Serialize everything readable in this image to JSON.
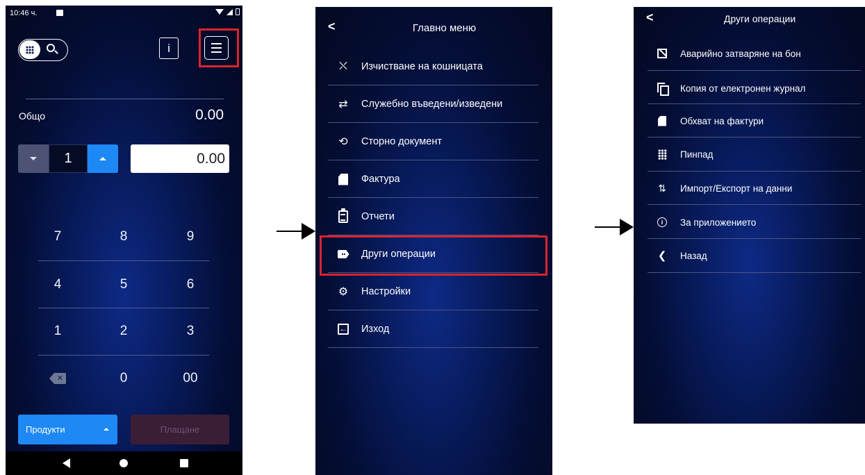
{
  "screen1": {
    "status_time": "10:46 ч.",
    "total_label": "Общо",
    "total_value": "0.00",
    "quantity": "1",
    "amount": "0.00",
    "info_label": "i",
    "keypad": [
      "7",
      "8",
      "9",
      "4",
      "5",
      "6",
      "1",
      "2",
      "3",
      "",
      "0",
      "00"
    ],
    "products_button": "Продукти",
    "pay_button": "Плащане",
    "colors": {
      "accent": "#1e88f5",
      "highlight": "#d9242e",
      "background": "#071a5a"
    }
  },
  "screen2": {
    "back_label": "<",
    "title": "Главно меню",
    "items": [
      {
        "icon": "cart-clear-icon",
        "glyph": "⛌",
        "label": "Изчистване на кошницата"
      },
      {
        "icon": "swap-arrows-icon",
        "glyph": "⇄",
        "label": "Служебно въведени/изведени"
      },
      {
        "icon": "refund-icon",
        "glyph": "⟲",
        "label": "Сторно документ"
      },
      {
        "icon": "invoice-icon",
        "glyph": "",
        "label": "Фактура"
      },
      {
        "icon": "clipboard-icon",
        "glyph": "",
        "label": "Отчети"
      },
      {
        "icon": "tag-icon",
        "glyph": "",
        "label": "Други операции"
      },
      {
        "icon": "gear-icon",
        "glyph": "⚙",
        "label": "Настройки"
      },
      {
        "icon": "exit-icon",
        "glyph": "←",
        "label": "Изход"
      }
    ]
  },
  "screen3": {
    "back_label": "<",
    "title": "Други операции",
    "items": [
      {
        "icon": "receipt-cancel-icon",
        "glyph": "",
        "label": "Аварийно затваряне на бон"
      },
      {
        "icon": "copy-icon",
        "glyph": "",
        "label": "Копия от електронен журнал"
      },
      {
        "icon": "invoice-icon",
        "glyph": "",
        "label": "Обхват на фактури"
      },
      {
        "icon": "pinpad-icon",
        "glyph": "",
        "label": "Пинпад"
      },
      {
        "icon": "import-export-icon",
        "glyph": "⇅",
        "label": "Импорт/Експорт на данни"
      },
      {
        "icon": "info-icon",
        "glyph": "i",
        "label": "За приложението"
      },
      {
        "icon": "chevron-left-icon",
        "glyph": "❮",
        "label": "Назад"
      }
    ]
  }
}
